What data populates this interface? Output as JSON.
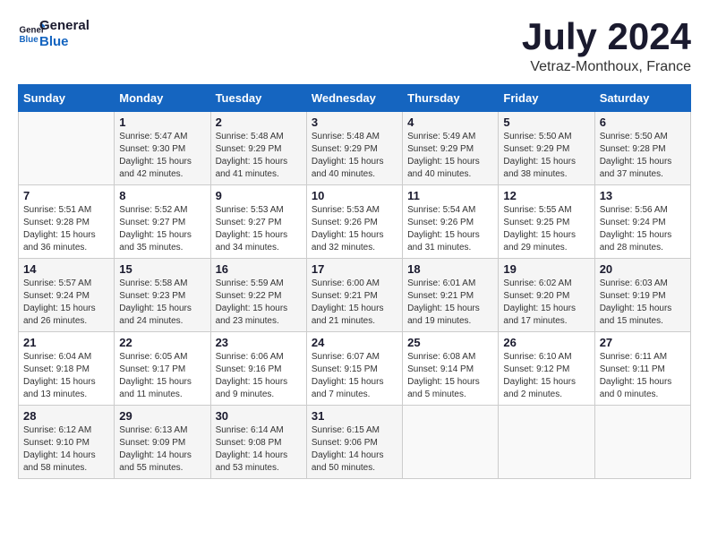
{
  "logo": {
    "line1": "General",
    "line2": "Blue"
  },
  "title": "July 2024",
  "subtitle": "Vetraz-Monthoux, France",
  "headers": [
    "Sunday",
    "Monday",
    "Tuesday",
    "Wednesday",
    "Thursday",
    "Friday",
    "Saturday"
  ],
  "weeks": [
    [
      {
        "day": "",
        "info": ""
      },
      {
        "day": "1",
        "info": "Sunrise: 5:47 AM\nSunset: 9:30 PM\nDaylight: 15 hours\nand 42 minutes."
      },
      {
        "day": "2",
        "info": "Sunrise: 5:48 AM\nSunset: 9:29 PM\nDaylight: 15 hours\nand 41 minutes."
      },
      {
        "day": "3",
        "info": "Sunrise: 5:48 AM\nSunset: 9:29 PM\nDaylight: 15 hours\nand 40 minutes."
      },
      {
        "day": "4",
        "info": "Sunrise: 5:49 AM\nSunset: 9:29 PM\nDaylight: 15 hours\nand 40 minutes."
      },
      {
        "day": "5",
        "info": "Sunrise: 5:50 AM\nSunset: 9:29 PM\nDaylight: 15 hours\nand 38 minutes."
      },
      {
        "day": "6",
        "info": "Sunrise: 5:50 AM\nSunset: 9:28 PM\nDaylight: 15 hours\nand 37 minutes."
      }
    ],
    [
      {
        "day": "7",
        "info": "Sunrise: 5:51 AM\nSunset: 9:28 PM\nDaylight: 15 hours\nand 36 minutes."
      },
      {
        "day": "8",
        "info": "Sunrise: 5:52 AM\nSunset: 9:27 PM\nDaylight: 15 hours\nand 35 minutes."
      },
      {
        "day": "9",
        "info": "Sunrise: 5:53 AM\nSunset: 9:27 PM\nDaylight: 15 hours\nand 34 minutes."
      },
      {
        "day": "10",
        "info": "Sunrise: 5:53 AM\nSunset: 9:26 PM\nDaylight: 15 hours\nand 32 minutes."
      },
      {
        "day": "11",
        "info": "Sunrise: 5:54 AM\nSunset: 9:26 PM\nDaylight: 15 hours\nand 31 minutes."
      },
      {
        "day": "12",
        "info": "Sunrise: 5:55 AM\nSunset: 9:25 PM\nDaylight: 15 hours\nand 29 minutes."
      },
      {
        "day": "13",
        "info": "Sunrise: 5:56 AM\nSunset: 9:24 PM\nDaylight: 15 hours\nand 28 minutes."
      }
    ],
    [
      {
        "day": "14",
        "info": "Sunrise: 5:57 AM\nSunset: 9:24 PM\nDaylight: 15 hours\nand 26 minutes."
      },
      {
        "day": "15",
        "info": "Sunrise: 5:58 AM\nSunset: 9:23 PM\nDaylight: 15 hours\nand 24 minutes."
      },
      {
        "day": "16",
        "info": "Sunrise: 5:59 AM\nSunset: 9:22 PM\nDaylight: 15 hours\nand 23 minutes."
      },
      {
        "day": "17",
        "info": "Sunrise: 6:00 AM\nSunset: 9:21 PM\nDaylight: 15 hours\nand 21 minutes."
      },
      {
        "day": "18",
        "info": "Sunrise: 6:01 AM\nSunset: 9:21 PM\nDaylight: 15 hours\nand 19 minutes."
      },
      {
        "day": "19",
        "info": "Sunrise: 6:02 AM\nSunset: 9:20 PM\nDaylight: 15 hours\nand 17 minutes."
      },
      {
        "day": "20",
        "info": "Sunrise: 6:03 AM\nSunset: 9:19 PM\nDaylight: 15 hours\nand 15 minutes."
      }
    ],
    [
      {
        "day": "21",
        "info": "Sunrise: 6:04 AM\nSunset: 9:18 PM\nDaylight: 15 hours\nand 13 minutes."
      },
      {
        "day": "22",
        "info": "Sunrise: 6:05 AM\nSunset: 9:17 PM\nDaylight: 15 hours\nand 11 minutes."
      },
      {
        "day": "23",
        "info": "Sunrise: 6:06 AM\nSunset: 9:16 PM\nDaylight: 15 hours\nand 9 minutes."
      },
      {
        "day": "24",
        "info": "Sunrise: 6:07 AM\nSunset: 9:15 PM\nDaylight: 15 hours\nand 7 minutes."
      },
      {
        "day": "25",
        "info": "Sunrise: 6:08 AM\nSunset: 9:14 PM\nDaylight: 15 hours\nand 5 minutes."
      },
      {
        "day": "26",
        "info": "Sunrise: 6:10 AM\nSunset: 9:12 PM\nDaylight: 15 hours\nand 2 minutes."
      },
      {
        "day": "27",
        "info": "Sunrise: 6:11 AM\nSunset: 9:11 PM\nDaylight: 15 hours\nand 0 minutes."
      }
    ],
    [
      {
        "day": "28",
        "info": "Sunrise: 6:12 AM\nSunset: 9:10 PM\nDaylight: 14 hours\nand 58 minutes."
      },
      {
        "day": "29",
        "info": "Sunrise: 6:13 AM\nSunset: 9:09 PM\nDaylight: 14 hours\nand 55 minutes."
      },
      {
        "day": "30",
        "info": "Sunrise: 6:14 AM\nSunset: 9:08 PM\nDaylight: 14 hours\nand 53 minutes."
      },
      {
        "day": "31",
        "info": "Sunrise: 6:15 AM\nSunset: 9:06 PM\nDaylight: 14 hours\nand 50 minutes."
      },
      {
        "day": "",
        "info": ""
      },
      {
        "day": "",
        "info": ""
      },
      {
        "day": "",
        "info": ""
      }
    ]
  ]
}
